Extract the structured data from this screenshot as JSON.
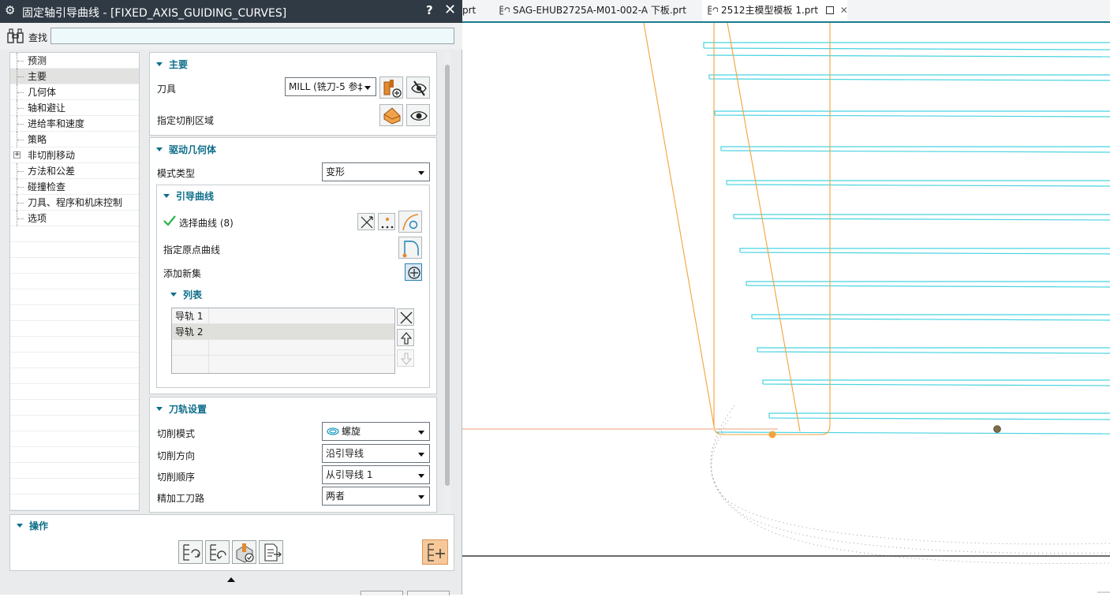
{
  "dialog": {
    "title": "固定轴引导曲线 - [FIXED_AXIS_GUIDING_CURVES]",
    "help": "?",
    "close": "✕",
    "find_label": "查找",
    "find_value": ""
  },
  "tree": {
    "items": [
      {
        "label": "预测"
      },
      {
        "label": "主要"
      },
      {
        "label": "几何体"
      },
      {
        "label": "轴和避让"
      },
      {
        "label": "进给率和速度"
      },
      {
        "label": "策略"
      },
      {
        "label": "非切削移动"
      },
      {
        "label": "方法和公差"
      },
      {
        "label": "碰撞检查"
      },
      {
        "label": "刀具、程序和机床控制"
      },
      {
        "label": "选项"
      }
    ],
    "selected": "主要"
  },
  "main": {
    "header": "主要",
    "tool_label": "刀具",
    "tool_value": "MILL (铣刀-5 参‡",
    "cut_area_label": "指定切削区域"
  },
  "drive": {
    "header": "驱动几何体",
    "mode_label": "模式类型",
    "mode_value": "变形",
    "guide": {
      "header": "引导曲线",
      "select_label": "选择曲线 (8)",
      "origin_label": "指定原点曲线",
      "add_set_label": "添加新集",
      "list_header": "列表",
      "rows": [
        "导轨  1",
        "导轨  2"
      ]
    }
  },
  "path": {
    "header": "刀轨设置",
    "cut_mode_label": "切削模式",
    "cut_mode_value": "螺旋",
    "cut_dir_label": "切削方向",
    "cut_dir_value": "沿引导线",
    "cut_order_label": "切削顺序",
    "cut_order_value": "从引导线 1",
    "finish_label": "精加工刀路",
    "finish_value": "两者"
  },
  "ops": {
    "header": "操作"
  },
  "tabs": [
    {
      "label": "prt"
    },
    {
      "label": "SAG-EHUB2725A-M01-002-A 下板.prt"
    },
    {
      "label": "2512主模型模板 1.prt"
    }
  ],
  "colors": {
    "accent": "#0d6e8a",
    "titlebar": "#2f3a44",
    "toolpath": "#46d3e0",
    "boundary": "#f2a23a",
    "generate_button": "#f6c89a"
  }
}
